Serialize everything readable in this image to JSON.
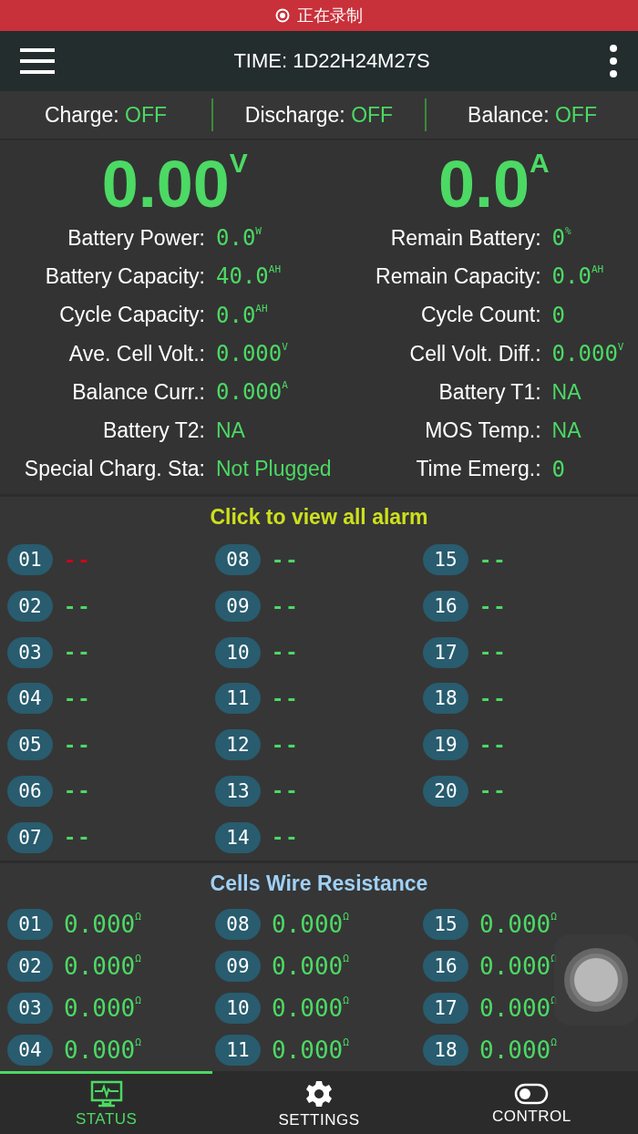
{
  "recording": {
    "label": "正在录制"
  },
  "header": {
    "title": "TIME: 1D22H24M27S"
  },
  "switches": [
    {
      "label": "Charge:",
      "value": "OFF"
    },
    {
      "label": "Discharge:",
      "value": "OFF"
    },
    {
      "label": "Balance:",
      "value": "OFF"
    }
  ],
  "main": [
    {
      "value": "0.00",
      "unit": "V"
    },
    {
      "value": "0.0",
      "unit": "A"
    }
  ],
  "stats": [
    {
      "label": "Battery Power:",
      "value": "0.0",
      "unit": "W"
    },
    {
      "label": "Remain Battery:",
      "value": "0",
      "unit": "%"
    },
    {
      "label": "Battery Capacity:",
      "value": "40.0",
      "unit": "AH"
    },
    {
      "label": "Remain Capacity:",
      "value": "0.0",
      "unit": "AH"
    },
    {
      "label": "Cycle Capacity:",
      "value": "0.0",
      "unit": "AH"
    },
    {
      "label": "Cycle Count:",
      "value": "0"
    },
    {
      "label": "Ave. Cell Volt.:",
      "value": "0.000",
      "unit": "V"
    },
    {
      "label": "Cell Volt. Diff.:",
      "value": "0.000",
      "unit": "V"
    },
    {
      "label": "Balance Curr.:",
      "value": "0.000",
      "unit": "A"
    },
    {
      "label": "Battery T1:",
      "value": "NA",
      "kind": "text"
    },
    {
      "label": "Battery T2:",
      "value": "NA",
      "kind": "text"
    },
    {
      "label": "MOS Temp.:",
      "value": "NA",
      "kind": "text"
    },
    {
      "label": "Special Charg. Sta:",
      "value": "Not Plugged",
      "kind": "text"
    },
    {
      "label": "Time Emerg.:",
      "value": "0"
    }
  ],
  "alarms": {
    "title": "Click to view all alarm",
    "items": [
      {
        "index": "01",
        "value": "--",
        "color": "#d0021b"
      },
      {
        "index": "02",
        "value": "--",
        "color": "#4cd964"
      },
      {
        "index": "03",
        "value": "--",
        "color": "#4cd964"
      },
      {
        "index": "04",
        "value": "--",
        "color": "#4cd964"
      },
      {
        "index": "05",
        "value": "--",
        "color": "#4cd964"
      },
      {
        "index": "06",
        "value": "--",
        "color": "#4cd964"
      },
      {
        "index": "07",
        "value": "--",
        "color": "#4cd964"
      },
      {
        "index": "08",
        "value": "--",
        "color": "#4cd964"
      },
      {
        "index": "09",
        "value": "--",
        "color": "#4cd964"
      },
      {
        "index": "10",
        "value": "--",
        "color": "#4cd964"
      },
      {
        "index": "11",
        "value": "--",
        "color": "#4cd964"
      },
      {
        "index": "12",
        "value": "--",
        "color": "#4cd964"
      },
      {
        "index": "13",
        "value": "--",
        "color": "#4cd964"
      },
      {
        "index": "14",
        "value": "--",
        "color": "#4cd964"
      },
      {
        "index": "15",
        "value": "--",
        "color": "#4cd964"
      },
      {
        "index": "16",
        "value": "--",
        "color": "#4cd964"
      },
      {
        "index": "17",
        "value": "--",
        "color": "#4cd964"
      },
      {
        "index": "18",
        "value": "--",
        "color": "#4cd964"
      },
      {
        "index": "19",
        "value": "--",
        "color": "#4cd964"
      },
      {
        "index": "20",
        "value": "--",
        "color": "#4cd964"
      }
    ]
  },
  "resistance": {
    "title": "Cells Wire Resistance",
    "items": [
      {
        "index": "01",
        "value": "0.000",
        "unit": "Ω"
      },
      {
        "index": "02",
        "value": "0.000",
        "unit": "Ω"
      },
      {
        "index": "03",
        "value": "0.000",
        "unit": "Ω"
      },
      {
        "index": "04",
        "value": "0.000",
        "unit": "Ω"
      },
      {
        "index": "08",
        "value": "0.000",
        "unit": "Ω"
      },
      {
        "index": "09",
        "value": "0.000",
        "unit": "Ω"
      },
      {
        "index": "10",
        "value": "0.000",
        "unit": "Ω"
      },
      {
        "index": "11",
        "value": "0.000",
        "unit": "Ω"
      },
      {
        "index": "15",
        "value": "0.000",
        "unit": "Ω"
      },
      {
        "index": "16",
        "value": "0.000",
        "unit": "Ω"
      },
      {
        "index": "17",
        "value": "0.000",
        "unit": "Ω"
      },
      {
        "index": "18",
        "value": "0.000",
        "unit": "Ω"
      }
    ]
  },
  "tabs": [
    {
      "label": "STATUS",
      "selected": true
    },
    {
      "label": "SETTINGS",
      "selected": false
    },
    {
      "label": "CONTROL",
      "selected": false
    }
  ]
}
